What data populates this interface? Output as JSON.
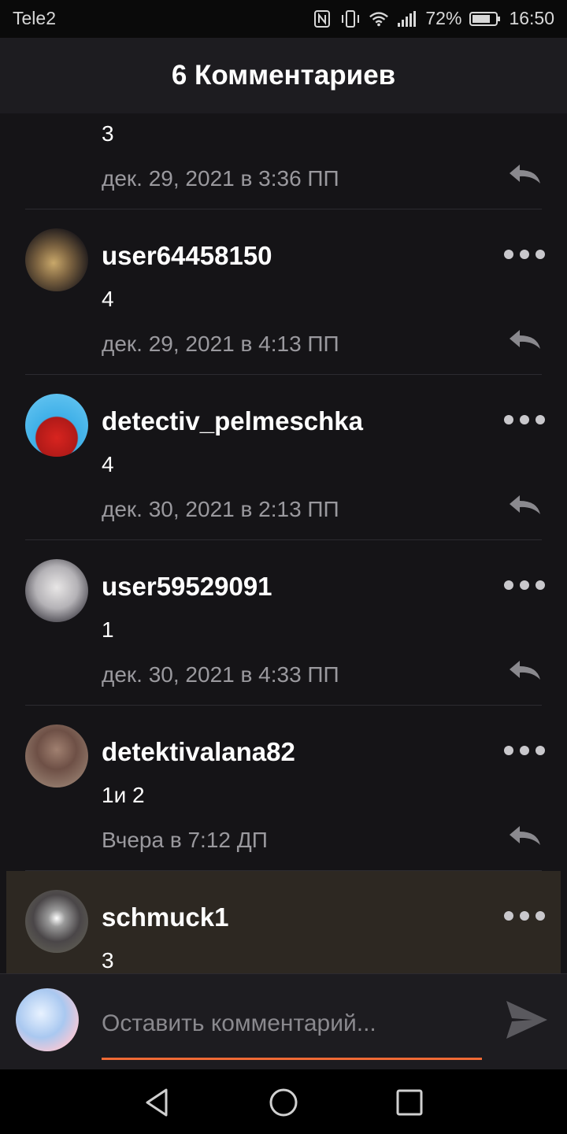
{
  "status_bar": {
    "carrier": "Tele2",
    "battery": "72%",
    "time": "16:50"
  },
  "header": {
    "title": "6 Комментариев"
  },
  "comments": [
    {
      "username": "",
      "text": "3",
      "time": "дек. 29, 2021 в 3:36 ПП"
    },
    {
      "username": "user64458150",
      "text": "4",
      "time": "дек. 29, 2021 в 4:13 ПП"
    },
    {
      "username": "detectiv_pelmeschka",
      "text": "4",
      "time": "дек. 30, 2021 в 2:13 ПП"
    },
    {
      "username": "user59529091",
      "text": "1",
      "time": "дек. 30, 2021 в 4:33 ПП"
    },
    {
      "username": "detektivalana82",
      "text": "1и 2",
      "time": "Вчера в 7:12 ДП"
    },
    {
      "username": "schmuck1",
      "text": "3",
      "time": ""
    }
  ],
  "input": {
    "placeholder": "Оставить комментарий..."
  },
  "icons": {
    "more": "more-dots-icon",
    "reply": "reply-arrow-icon",
    "send": "send-icon",
    "nav_back": "triangle-back-icon",
    "nav_home": "circle-home-icon",
    "nav_recents": "square-recents-icon"
  },
  "colors": {
    "accent": "#f06a35",
    "background": "#151417",
    "highlight_row": "#2d2822",
    "secondary_text": "#9a999e"
  }
}
